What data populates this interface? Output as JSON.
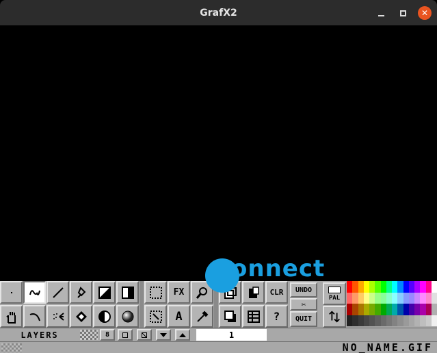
{
  "window": {
    "title": "GrafX2",
    "close_glyph": "✕"
  },
  "tools": {
    "row1": [
      "pixel-icon",
      "freehand-icon",
      "line-icon",
      "spray-icon",
      "gradient-rect-icon",
      "gradient-icon"
    ],
    "row2": [
      "hand-icon",
      "curve-icon",
      "airbrush-icon",
      "fill-icon",
      "circle-fill-icon",
      "sphere-icon"
    ],
    "fx_label": "FX",
    "text_label": "A",
    "clr_label": "CLR",
    "undo_label": "UNDO",
    "swap_label": "✂",
    "quit_label": "QUIT",
    "help_label": "?",
    "pal_label": "PAL"
  },
  "layers": {
    "label": "LAYERS",
    "btn_8": "8",
    "current_layer": "1"
  },
  "status": {
    "filename": "NO_NAME.GIF"
  },
  "watermark": {
    "text": "onnect"
  },
  "palette_colors": [
    "#ff0000",
    "#ff5500",
    "#ffaa00",
    "#ffff00",
    "#aaff00",
    "#55ff00",
    "#00ff00",
    "#00ff88",
    "#00ffff",
    "#0088ff",
    "#0000ff",
    "#5500ff",
    "#aa00ff",
    "#ff00ff",
    "#ff0088",
    "#ffffff",
    "#ff6666",
    "#ff9966",
    "#ffcc66",
    "#ffff88",
    "#ccff88",
    "#99ff88",
    "#88ff99",
    "#88ffcc",
    "#88ffff",
    "#88ccff",
    "#8899ff",
    "#9988ff",
    "#cc88ff",
    "#ff88ff",
    "#ff88cc",
    "#e0e0e0",
    "#aa0000",
    "#aa4400",
    "#aa7700",
    "#aaaa00",
    "#77aa00",
    "#44aa00",
    "#00aa00",
    "#00aa55",
    "#00aaaa",
    "#0055aa",
    "#0000aa",
    "#4400aa",
    "#7700aa",
    "#aa00aa",
    "#aa0055",
    "#b0b0b0",
    "#222222",
    "#2e2e2e",
    "#3a3a3a",
    "#464646",
    "#525252",
    "#5e5e5e",
    "#6a6a6a",
    "#767676",
    "#828282",
    "#8e8e8e",
    "#9a9a9a",
    "#a6a6a6",
    "#b2b2b2",
    "#bebebe",
    "#cacaca",
    "#f0f0f0"
  ]
}
